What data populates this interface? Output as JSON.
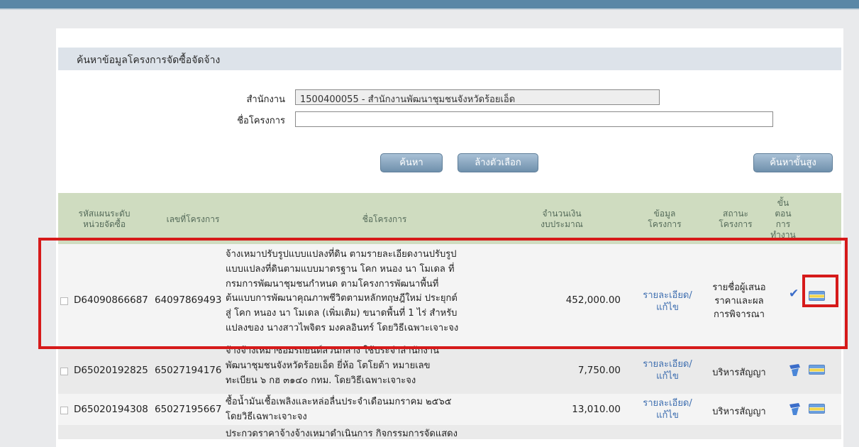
{
  "search": {
    "title": "ค้นหาข้อมูลโครงการจัดซื้อจัดจ้าง",
    "office_label": "สำนักงาน",
    "office_value": "1500400055 - สำนักงานพัฒนาชุมชนจังหวัดร้อยเอ็ด",
    "project_label": "ชื่อโครงการ",
    "project_value": "",
    "search_button": "ค้นหา",
    "clear_button": "ล้างตัวเลือก",
    "advanced_button": "ค้นหาขั้นสูง"
  },
  "table": {
    "headers": {
      "plan_code": [
        "รหัสแผนระดับ",
        "หน่วยจัดซื้อ"
      ],
      "project_no": "เลขที่โครงการ",
      "project_name": "ชื่อโครงการ",
      "budget": [
        "จำนวนเงิน",
        "งบประมาณ"
      ],
      "info": [
        "ข้อมูล",
        "โครงการ"
      ],
      "status": [
        "สถานะ",
        "โครงการ"
      ],
      "step": [
        "ขั้น",
        "ตอน",
        "การ",
        "ทำงาน"
      ]
    },
    "rows": [
      {
        "plan_code": "D64090866687",
        "project_no": "64097869493",
        "name_lines": [
          "จ้างเหมาปรับรูปแบบแปลงที่ดิน ตามรายละเอียดงานปรับรูป",
          "แบบแปลงที่ดินตามแบบมาตรฐาน โคก หนอง นา โมเดล ที่",
          "กรมการพัฒนาชุมชนกำหนด ตามโครงการพัฒนาพื้นที่",
          "ต้นแบบการพัฒนาคุณภาพชีวิตตามหลักทฤษฎีใหม่ ประยุกต์",
          "สู่ โคก หนอง นา โมเดล (เพิ่มเติม) ขนาดพื้นที่ 1 ไร่ สำหรับ",
          "แปลงของ นางสาวไพจิตร มงคลอินทร์ โดยวิธีเฉพาะเจาะจง"
        ],
        "budget": "452,000.00",
        "info": [
          "รายละเอียด/",
          "แก้ไข"
        ],
        "status": [
          "รายชื่อผู้เสนอ",
          "ราคาและผล",
          "การพิจารณา"
        ]
      },
      {
        "plan_code": "D65020192825",
        "project_no": "65027194176",
        "name_lines": [
          "จ้างจ้างเหมาซ่อมรถยนต์ส่วนกลาง ใช้ประจำสำนักงาน",
          "พัฒนาชุมชนจังหวัดร้อยเอ็ด ยี่ห้อ โตโยต้า หมายเลข",
          "ทะเบียน ๖ กฮ ๓๑๔๐ กทม. โดยวิธีเฉพาะเจาะจง"
        ],
        "budget": "7,750.00",
        "info": [
          "รายละเอียด/",
          "แก้ไข"
        ],
        "status": [
          "บริหารสัญญา"
        ]
      },
      {
        "plan_code": "D65020194308",
        "project_no": "65027195667",
        "name_lines": [
          "ซื้อน้ำมันเชื้อเพลิงและหล่อลื่นประจำเดือนมกราคม ๒๕๖๕",
          "โดยวิธีเฉพาะเจาะจง"
        ],
        "budget": "13,010.00",
        "info": [
          "รายละเอียด/",
          "แก้ไข"
        ],
        "status": [
          "บริหารสัญญา"
        ]
      },
      {
        "name_lines": [
          "ประกวดราคาจ้างจ้างเหมาดำเนินการ กิจกรรมการจัดแสดง"
        ]
      }
    ]
  },
  "colors": {
    "header_band": "#5a87a6",
    "table_header": "#cfdcc0",
    "link": "#3f6fb0",
    "highlight": "#d61a1a"
  }
}
